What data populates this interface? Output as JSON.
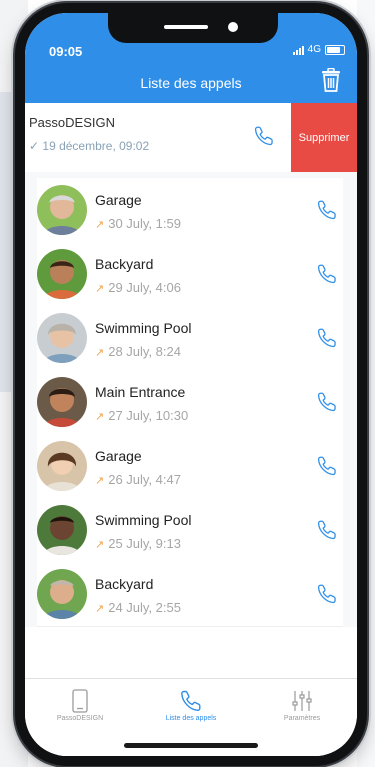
{
  "status_bar": {
    "time": "09:05",
    "network": "4G"
  },
  "header": {
    "title": "Liste des appels"
  },
  "swipe_row": {
    "name": "PassoDESIGN",
    "date": "19 décembre, 09:02",
    "delete_label": "Supprimer"
  },
  "calls": [
    {
      "name": "Garage",
      "date": "30 July, 1:59"
    },
    {
      "name": "Backyard",
      "date": "29 July, 4:06"
    },
    {
      "name": "Swimming Pool",
      "date": "28 July, 8:24"
    },
    {
      "name": "Main Entrance",
      "date": "27 July, 10:30"
    },
    {
      "name": "Garage",
      "date": "26 July, 4:47"
    },
    {
      "name": "Swimming Pool",
      "date": "25 July, 9:13"
    },
    {
      "name": "Backyard",
      "date": "24 July, 2:55"
    }
  ],
  "tabs": [
    {
      "label": "PassoDESIGN",
      "icon": "device-icon"
    },
    {
      "label": "Liste des appels",
      "icon": "phone-icon"
    },
    {
      "label": "Paramètres",
      "icon": "sliders-icon"
    }
  ],
  "colors": {
    "accent": "#2f8fe8",
    "delete": "#e84b44",
    "outgoing_arrow": "#f0a34c"
  }
}
